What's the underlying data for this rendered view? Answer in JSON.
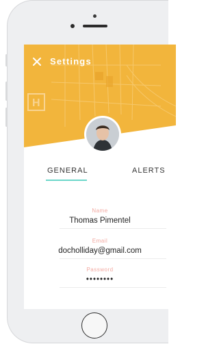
{
  "app": {
    "title": "Settings"
  },
  "tabs": [
    {
      "label": "GENERAL",
      "active": true
    },
    {
      "label": "ALERTS",
      "active": false
    }
  ],
  "profile": {
    "name_label": "Name",
    "name_value": "Thomas Pimentel",
    "email_label": "Email",
    "email_value": "docholliday@gmail.com",
    "password_label": "Password",
    "password_value": "••••••••"
  },
  "icons": {
    "close": "close-icon",
    "avatar": "avatar"
  },
  "colors": {
    "header": "#f2b53c",
    "tab_accent": "#6bd6c9",
    "label": "#f2a8a0"
  }
}
